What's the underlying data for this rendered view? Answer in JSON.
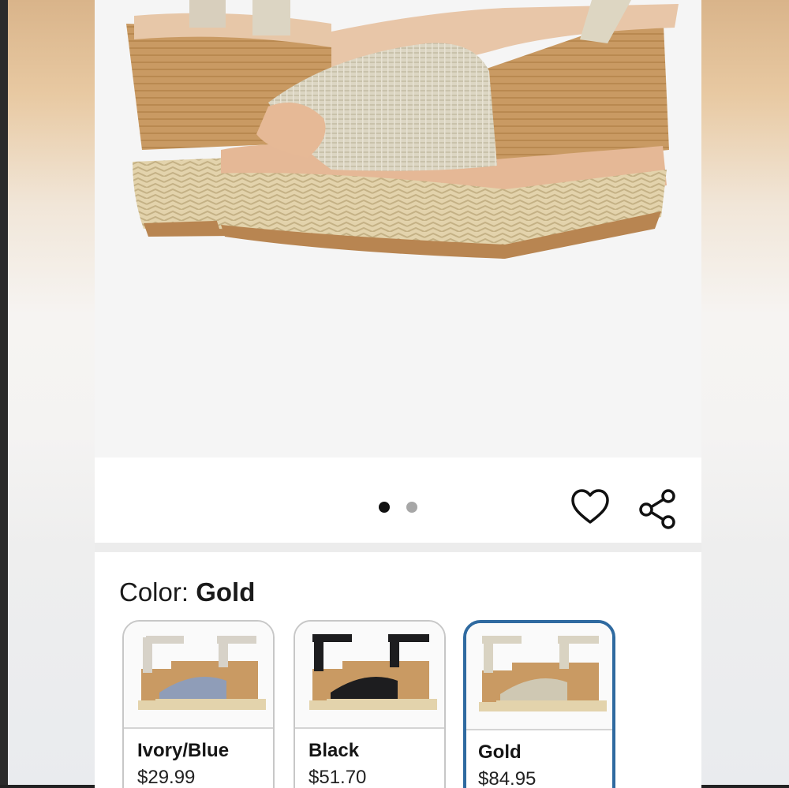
{
  "product": {
    "image_alt": "Gold espadrille wedge sandals",
    "carousel": {
      "total_images": 2,
      "current_index": 1
    }
  },
  "actions": {
    "favorite_icon": "heart-outline-icon",
    "share_icon": "share-icon"
  },
  "color": {
    "label": "Color: ",
    "selected": "Gold",
    "options": [
      {
        "name": "Ivory/Blue",
        "price": "$29.99",
        "strap_color": "#d7d2c8",
        "band_color": "#8f9db8"
      },
      {
        "name": "Black",
        "price": "$51.70",
        "strap_color": "#1d1d1f",
        "band_color": "#1d1d1f"
      },
      {
        "name": "Gold",
        "price": "$84.95",
        "strap_color": "#d9d3c2",
        "band_color": "#cfc8b3"
      }
    ]
  },
  "colors": {
    "selected_border": "#2f6aa0",
    "dot_active": "#111111",
    "dot_inactive": "#a7a7a7"
  }
}
